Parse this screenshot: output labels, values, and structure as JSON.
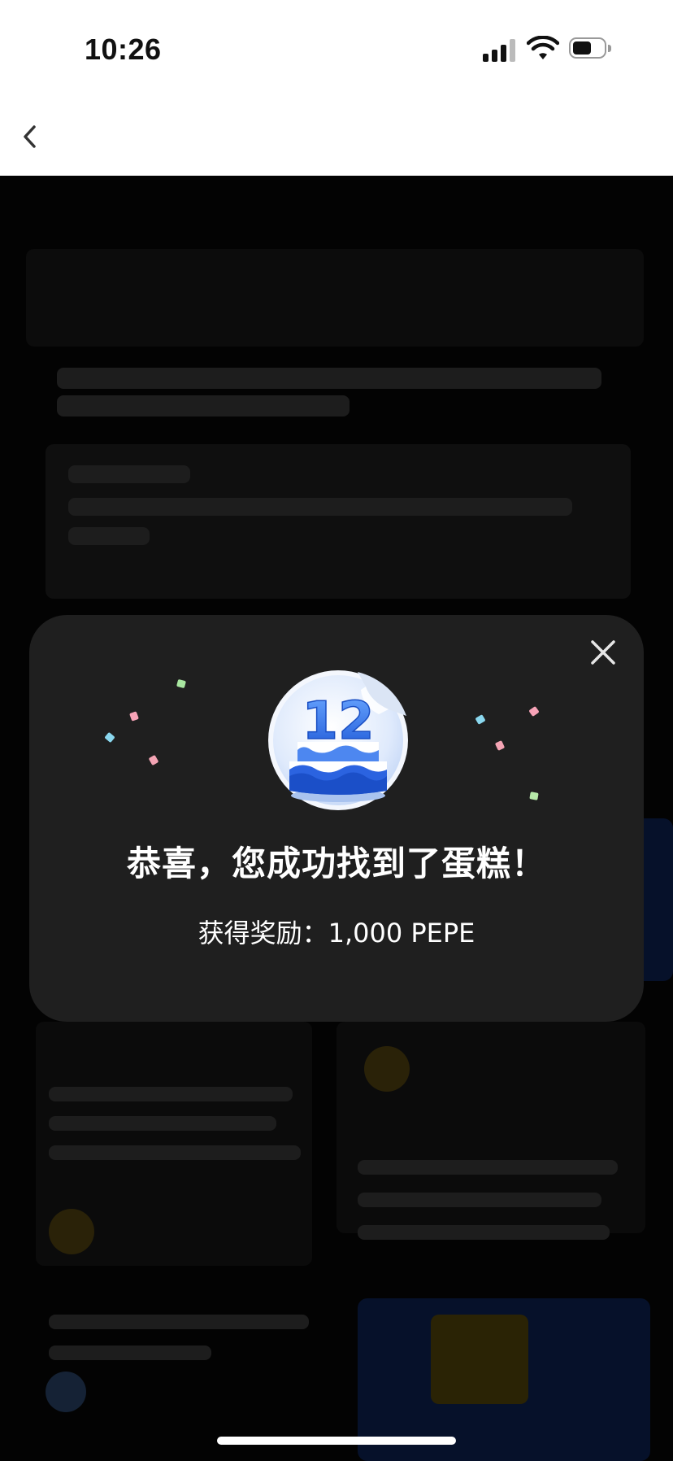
{
  "status_bar": {
    "time": "10:26"
  },
  "nav": {
    "back_icon": "chevron-left-icon"
  },
  "modal": {
    "close_icon": "close-icon",
    "badge_icon": "birthday-cake-icon",
    "badge_number": "12",
    "title": "恭喜，您成功找到了蛋糕！",
    "reward": "获得奖励：1,000 PEPE"
  },
  "colors": {
    "modal_bg": "#1f1f1f",
    "page_bg": "#000000",
    "badge_blue": "#2f6be8"
  }
}
